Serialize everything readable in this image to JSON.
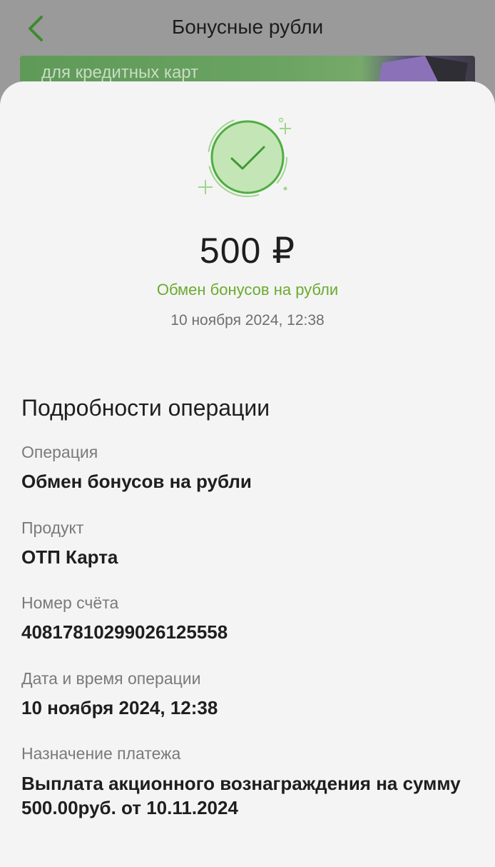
{
  "header": {
    "title": "Бонусные рубли",
    "back_icon": "chevron-left-icon",
    "accent": "#4a9a3a"
  },
  "banner": {
    "text": "для кредитных карт"
  },
  "receipt": {
    "status_icon": "checkmark-circle-icon",
    "amount": "500 ₽",
    "operation_title": "Обмен бонусов на рубли",
    "datetime": "10 ноября 2024, 12:38",
    "success_color": "#6aab2f"
  },
  "details": {
    "title": "Подробности операции",
    "fields": [
      {
        "label": "Операция",
        "value": "Обмен бонусов на рубли"
      },
      {
        "label": "Продукт",
        "value": "ОТП Карта"
      },
      {
        "label": "Номер счёта",
        "value": "40817810299026125558"
      },
      {
        "label": "Дата и время операции",
        "value": "10 ноября 2024, 12:38"
      },
      {
        "label": "Назначение платежа",
        "value": "Выплата акционного вознаграждения на сумму 500.00руб. от 10.11.2024"
      }
    ]
  }
}
